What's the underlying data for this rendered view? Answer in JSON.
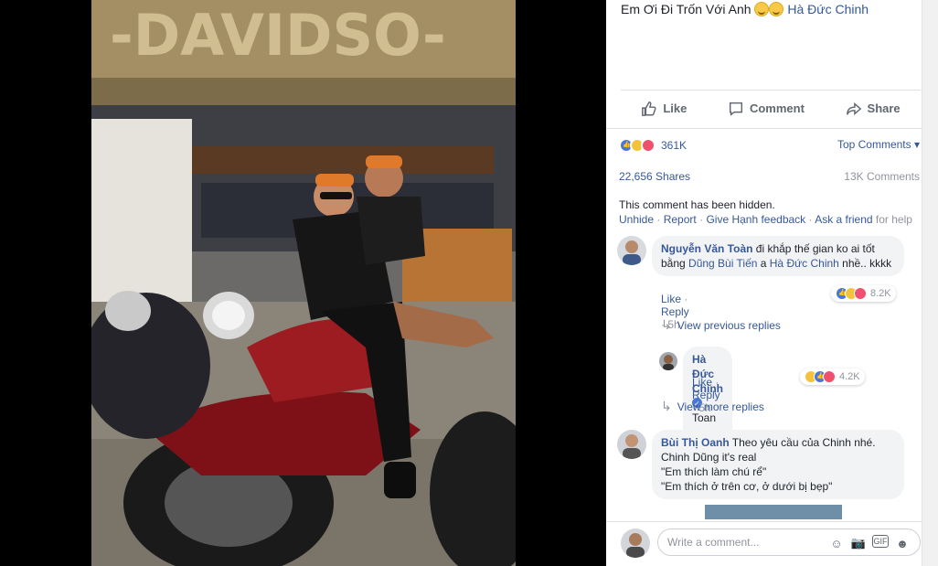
{
  "post": {
    "caption_text": "Em Ơi Đi Trốn Với Anh",
    "caption_tag": "Hà Đức Chinh"
  },
  "actions": {
    "like": "Like",
    "comment": "Comment",
    "share": "Share"
  },
  "stats": {
    "reactions_count": "361K",
    "top_comments": "Top Comments ▾",
    "shares": "22,656 Shares",
    "comments": "13K Comments"
  },
  "hidden_comment": {
    "message": "This comment has been hidden.",
    "unhide": "Unhide",
    "report": "Report",
    "give_feedback": "Give Hạnh feedback",
    "ask_friend": "Ask a friend",
    "for_help": " for help"
  },
  "comments": [
    {
      "name": "Nguyễn Văn Toàn",
      "text_1": " đi khắp thế gian ko ai tốt bằng ",
      "tag_1": "Dũng Bùi Tiến",
      "text_2": " a ",
      "tag_2": "Hà Đức Chinh",
      "text_3": " nhề.. kkkk",
      "like": "Like",
      "reply": "Reply",
      "time": "5h",
      "reaction_count": "8.2K"
    },
    {
      "name": "Hà Đức Chinh",
      "text": "Toan ngoan di",
      "like": "Like",
      "reply": "Reply",
      "time": "5h",
      "reaction_count": "4.2K"
    },
    {
      "name": "Bùi Thị Oanh",
      "text_1": " Theo yêu cầu của Chinh nhé. Chinh Dũng it's real",
      "text_2": "\"Em thích làm chú rể\"",
      "text_3": "\"Em thích ở trên cơ, ở dưới bị bẹp\""
    }
  ],
  "replies": {
    "view_previous": "View previous replies",
    "view_more": "View more replies"
  },
  "composer": {
    "placeholder": "Write a comment..."
  },
  "colors": {
    "link": "#365899",
    "like_blue": "#4a76d8",
    "haha_yellow": "#f5c33b",
    "love_red": "#f0506e"
  },
  "icons": [
    "like-icon",
    "comment-icon",
    "share-icon",
    "emoji-icon",
    "camera-icon",
    "gif-icon",
    "sticker-icon",
    "verified-icon"
  ]
}
